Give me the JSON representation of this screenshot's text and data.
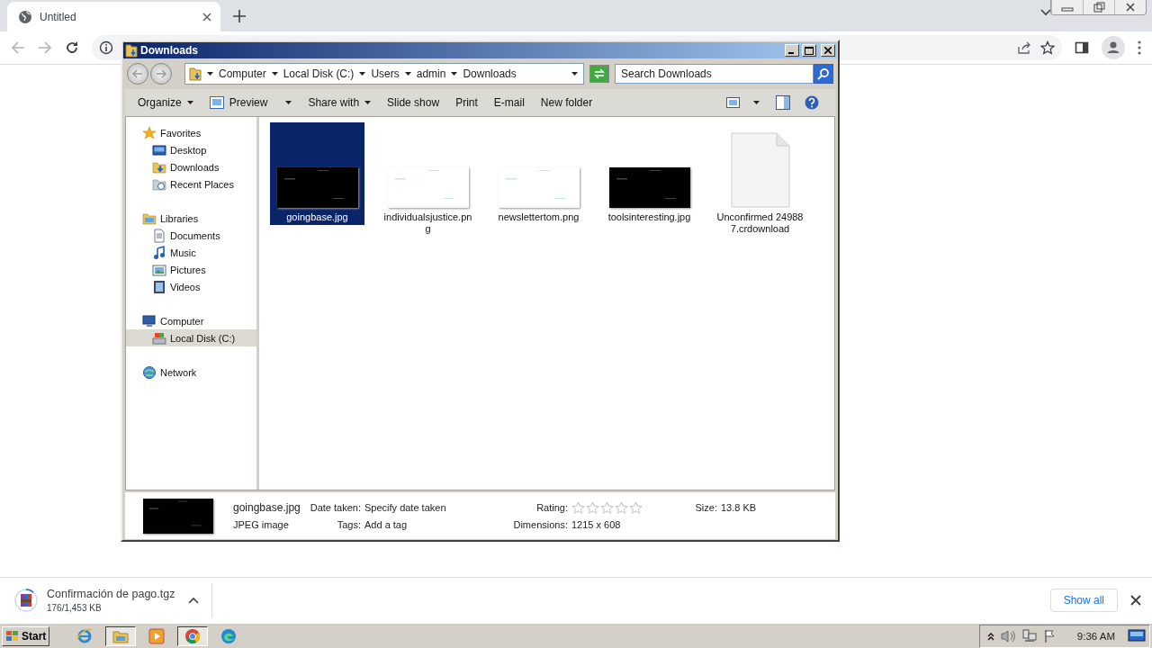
{
  "browser": {
    "tabs": [
      {
        "title": "Untitled",
        "selected": true
      }
    ]
  },
  "explorer": {
    "title": "Downloads",
    "breadcrumb": [
      "Computer",
      "Local Disk (C:)",
      "Users",
      "admin",
      "Downloads"
    ],
    "search": {
      "placeholder": "Search Downloads"
    },
    "commands": [
      {
        "label": "Organize",
        "kind": "menu"
      },
      {
        "label": "Preview",
        "kind": "split"
      },
      {
        "label": "Share with",
        "kind": "menu"
      },
      {
        "label": "Slide show",
        "kind": "plain"
      },
      {
        "label": "Print",
        "kind": "plain"
      },
      {
        "label": "E-mail",
        "kind": "plain"
      },
      {
        "label": "New folder",
        "kind": "plain"
      }
    ],
    "nav": [
      {
        "label": "Favorites",
        "kind": "star",
        "selected": false,
        "children": [
          {
            "label": "Desktop",
            "kind": "desktop",
            "selected": false
          },
          {
            "label": "Downloads",
            "kind": "downloads",
            "selected": false
          },
          {
            "label": "Recent Places",
            "kind": "places",
            "selected": false
          }
        ]
      },
      {
        "label": "Libraries",
        "kind": "library",
        "selected": false,
        "children": [
          {
            "label": "Documents",
            "kind": "document",
            "selected": false
          },
          {
            "label": "Music",
            "kind": "music",
            "selected": false
          },
          {
            "label": "Pictures",
            "kind": "pictures",
            "selected": false
          },
          {
            "label": "Videos",
            "kind": "videos",
            "selected": false
          }
        ]
      },
      {
        "label": "Computer",
        "kind": "computer",
        "selected": false,
        "children": [
          {
            "label": "Local Disk (C:)",
            "kind": "drive",
            "selected": true
          }
        ]
      },
      {
        "label": "Network",
        "kind": "network",
        "selected": false
      }
    ],
    "files": [
      {
        "name": "goingbase.jpg",
        "kind": "picture",
        "selected": true
      },
      {
        "name": "individualsjustice.png",
        "kind": "picture",
        "selected": false
      },
      {
        "name": "newslettertom.png",
        "kind": "picture",
        "selected": false
      },
      {
        "name": "toolsinteresting.jpg",
        "kind": "picture",
        "selected": false
      },
      {
        "name": "Unconfirmed 249887.crdownload",
        "kind": "document",
        "selected": false
      }
    ],
    "details": {
      "name": "goingbase.jpg",
      "type": "JPEG image",
      "rows": [
        [
          {
            "label": "Date taken:",
            "value": "Specify date taken"
          },
          {
            "label": "Rating:",
            "stars": 0
          },
          {
            "label": "Size:",
            "value": "13.8 KB"
          }
        ],
        [
          {
            "label": "Tags:",
            "value": "Add a tag"
          },
          {
            "label": "Dimensions:",
            "value": "1215 x 608"
          }
        ]
      ]
    }
  },
  "download_bar": {
    "items": [
      {
        "name": "Confirmación de pago.tgz",
        "progress": "176/1,453 KB",
        "level": 0.12
      }
    ],
    "show_all": "Show all"
  },
  "taskbar": {
    "start": "Start",
    "apps": [
      {
        "kind": "ie",
        "selected": false
      },
      {
        "kind": "explorer",
        "selected": true
      },
      {
        "kind": "media",
        "selected": false
      },
      {
        "kind": "chrome",
        "selected": true
      },
      {
        "kind": "edge",
        "selected": false
      }
    ],
    "clock": "9:36 AM"
  }
}
